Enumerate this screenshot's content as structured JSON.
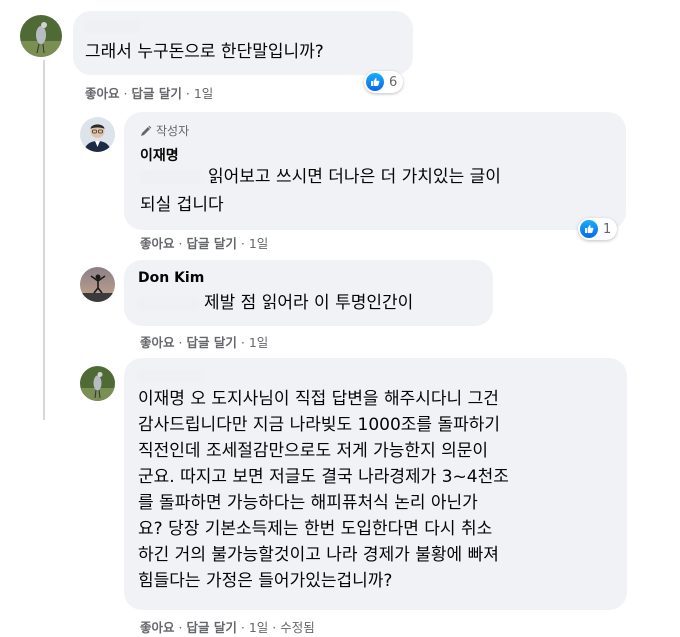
{
  "comments": [
    {
      "text_lines": [
        "그래서 누구돈으로 한단말입니까?"
      ],
      "actions": {
        "like": "좋아요",
        "reply": "답글 달기",
        "time": "1일"
      },
      "reactions": {
        "icon": "like-icon",
        "count": "6"
      }
    },
    {
      "badge": "작성자",
      "author": "이재명",
      "text_lines": [
        "읽어보고 쓰시면 더나은 더 가치있는 글이",
        "되실 겁니다"
      ],
      "actions": {
        "like": "좋아요",
        "reply": "답글 달기",
        "time": "1일"
      },
      "reactions": {
        "icon": "like-icon",
        "count": "1"
      }
    },
    {
      "author": "Don Kim",
      "text_lines": [
        "제발 점 읽어라 이 투명인간이"
      ],
      "actions": {
        "like": "좋아요",
        "reply": "답글 달기",
        "time": "1일"
      }
    },
    {
      "text_lines": [
        "이재명 오 도지사님이 직접 답변을 해주시다니 그건",
        "감사드립니다만 지금 나라빚도 1000조를 돌파하기",
        "직전인데 조세절감만으로도 저게 가능한지 의문이",
        "군요. 따지고 보면 저글도 결국 나라경제가 3~4천조",
        "를 돌파하면 가능하다는 해피퓨처식 논리 아닌가",
        "요? 당장 기본소득제는 한번 도입한다면 다시 취소",
        "하긴 거의 불가능할것이고 나라 경제가 불황에 빠져",
        "힘들다는 가정은 들어가있는겁니까?"
      ],
      "actions": {
        "like": "좋아요",
        "reply": "답글 달기",
        "time": "1일",
        "edited": "수정됨"
      }
    }
  ],
  "colors": {
    "bubble": "#f0f2f5",
    "meta": "#65676b",
    "like_blue": "#1877f2"
  }
}
